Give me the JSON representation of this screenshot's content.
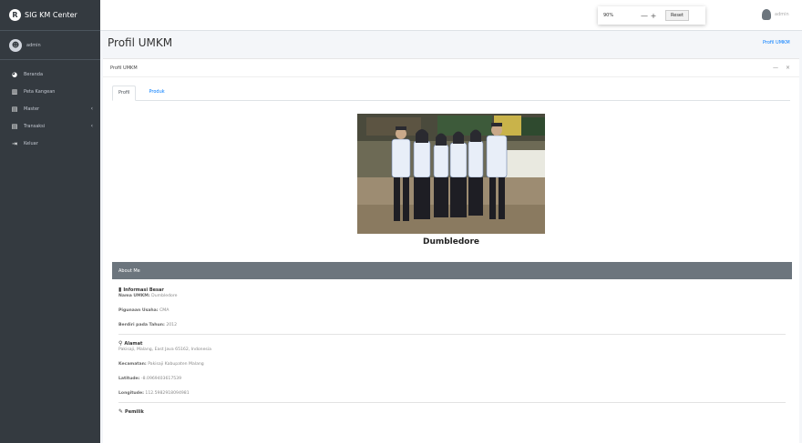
{
  "app": {
    "title": "SIG KM Center",
    "logo_letter": "R"
  },
  "sidebar": {
    "user": "admin",
    "items": [
      {
        "icon": "dashboard-icon",
        "glyph": "◕",
        "label": "Beranda",
        "chevron": ""
      },
      {
        "icon": "map-icon",
        "glyph": "▥",
        "label": "Peta Kangean",
        "chevron": ""
      },
      {
        "icon": "database-icon",
        "glyph": "▤",
        "label": "Master",
        "chevron": "‹"
      },
      {
        "icon": "database-icon",
        "glyph": "▤",
        "label": "Transaksi",
        "chevron": "‹"
      },
      {
        "icon": "logout-icon",
        "glyph": "⇥",
        "label": "Keluar",
        "chevron": ""
      }
    ]
  },
  "zoom": {
    "percent": "90%",
    "minus": "—",
    "plus": "+",
    "reset": "Reset"
  },
  "topbar": {
    "user": "admin"
  },
  "page": {
    "title": "Profil UMKM",
    "breadcrumb": "Profil UMKM"
  },
  "card": {
    "title": "Profil UMKM",
    "tools": {
      "collapse": "—",
      "close": "×"
    },
    "tabs": [
      {
        "label": "Profil"
      },
      {
        "label": "Produk"
      }
    ],
    "photo_caption": "Dumbledore",
    "about_title": "About Me",
    "info": {
      "title": "Informasi Besar",
      "nama_label": "Nama UMKM:",
      "nama_value": "Dumbledore",
      "pg_label": "Pigunaan Usaha:",
      "pg_value": "CMA",
      "berdiri_label": "Berdiri pada Tahun:",
      "berdiri_value": "2012"
    },
    "alamat": {
      "title": "Alamat",
      "address": "Pakisaji, Malang, East Java 65162, Indonesia",
      "kec_label": "Kecamatan:",
      "kec_value": "Pakisaji Kabupaten Malang",
      "lat_label": "Latitude:",
      "lat_value": "-8.0969403617539",
      "lng_label": "Longitude:",
      "lng_value": "112.5982918094981"
    },
    "pemilik": {
      "title": "Pemilik"
    }
  },
  "colors": {
    "sidebar": "#343a40",
    "about_head": "#6c757d",
    "link": "#007bff"
  }
}
